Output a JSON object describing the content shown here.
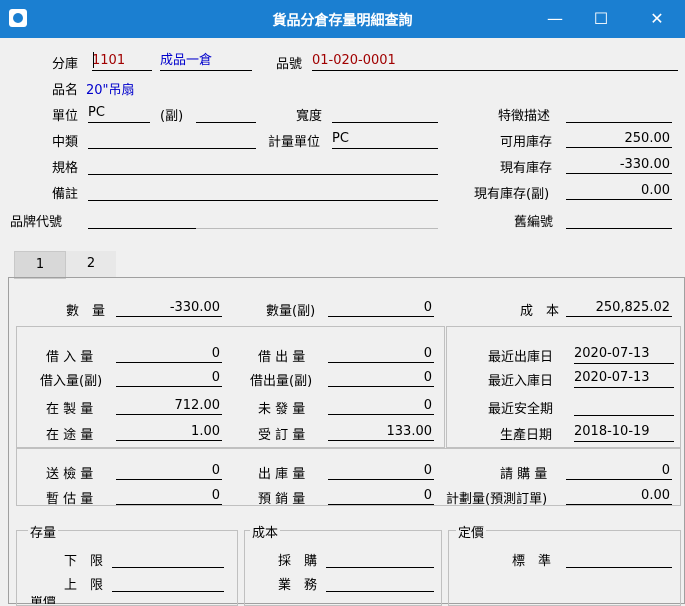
{
  "window": {
    "title": "貨品分倉存量明細查詢",
    "minimize": "—",
    "maximize": "☐",
    "close": "✕"
  },
  "header": {
    "warehouse_label": "分庫",
    "warehouse_code": "1101",
    "warehouse_name": "成品一倉",
    "item_no_label": "品號",
    "item_no": "01-020-0001",
    "item_name_label": "品名",
    "item_name": "20\"吊扇",
    "unit_label": "單位",
    "unit": "PC",
    "sub_label": "(副)",
    "sub_value": "",
    "width_label": "寬度",
    "width": "",
    "feature_label": "特徵描述",
    "feature": "",
    "midclass_label": "中類",
    "midclass": "",
    "meas_unit_label": "計量單位",
    "meas_unit": "PC",
    "avail_label": "可用庫存",
    "avail": "250.00",
    "spec_label": "規格",
    "spec": "",
    "curstock_label": "現有庫存",
    "curstock": "-330.00",
    "note_label": "備註",
    "note": "",
    "curstock_sub_label": "現有庫存(副)",
    "curstock_sub": "0.00",
    "brand_label": "品牌代號",
    "brand": "",
    "old_no_label": "舊編號",
    "old_no": ""
  },
  "tabs": [
    {
      "label": "1"
    },
    {
      "label": "2"
    }
  ],
  "tab1": {
    "qty_label": "數　量",
    "qty": "-330.00",
    "qty_sub_label": "數量(副)",
    "qty_sub": "0",
    "cost_label": "成　本",
    "cost": "250,825.02",
    "borrow_in_label": "借 入 量",
    "borrow_in": "0",
    "borrow_out_label": "借 出 量",
    "borrow_out": "0",
    "last_out_label": "最近出庫日",
    "last_out": "2020-07-13",
    "borrow_in_sub_label": "借入量(副)",
    "borrow_in_sub": "0",
    "borrow_out_sub_label": "借出量(副)",
    "borrow_out_sub": "0",
    "last_in_label": "最近入庫日",
    "last_in": "2020-07-13",
    "wip_label": "在 製 量",
    "wip": "712.00",
    "unshipped_label": "未 發 量",
    "unshipped": "0",
    "safety_label": "最近安全期",
    "safety": "",
    "transit_label": "在 途 量",
    "transit": "1.00",
    "ordered_label": "受 訂 量",
    "ordered": "133.00",
    "prod_date_label": "生產日期",
    "prod_date": "2018-10-19",
    "inspect_label": "送 檢 量",
    "inspect": "0",
    "out_label": "出 庫 量",
    "out": "0",
    "purchase_req_label": "請 購 量",
    "purchase_req": "0",
    "temp_label": "暫 估 量",
    "temp": "0",
    "presale_label": "預 銷 量",
    "presale": "0",
    "plan_label": "計劃量(預測訂單)",
    "plan": "0.00",
    "stock_group": "存量",
    "lower_label": "下　限",
    "lower": "",
    "upper_label": "上　限",
    "upper": "",
    "cost_group": "成本",
    "purchase_label": "採　購",
    "purchase": "",
    "business_label": "業　務",
    "business": "",
    "price_group": "定價",
    "standard_label": "標　準",
    "standard": "",
    "cut_label": "單價"
  }
}
